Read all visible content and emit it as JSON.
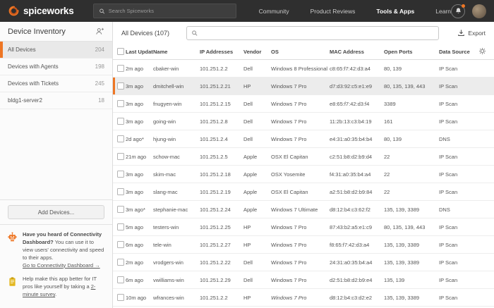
{
  "colors": {
    "accent_orange": "#ee7624",
    "topbar_bg": "#2f2f2f",
    "selected_row_bg": "#ececec",
    "survey_icon_yellow": "#e3b71f"
  },
  "topbar": {
    "logo_text": "spiceworks",
    "search_placeholder": "Search Spiceworks",
    "nav": [
      {
        "label": "Community",
        "active": false
      },
      {
        "label": "Product Reviews",
        "active": false
      },
      {
        "label": "Tools & Apps",
        "active": true
      },
      {
        "label": "Learn",
        "active": false
      }
    ]
  },
  "sidebar": {
    "title": "Device Inventory",
    "items": [
      {
        "label": "All Devices",
        "count": "204",
        "selected": true
      },
      {
        "label": "Devices with Agents",
        "count": "198",
        "selected": false
      },
      {
        "label": "Devices with Tickets",
        "count": "245",
        "selected": false
      },
      {
        "label": "bldg1-server2",
        "count": "18",
        "selected": false
      }
    ],
    "add_button": "Add Devices...",
    "promo": {
      "bold": "Have you heard of Connectivity Dashboard?",
      "text": " You can use it to view users' connectivity and speed to their apps.",
      "link": "Go to Connectivity Dashboard →"
    },
    "survey": {
      "before": "Help make this app better for IT pros like yourself by taking a ",
      "link": "2-minute survey",
      "after": "."
    }
  },
  "main": {
    "title": "All Devices (107)",
    "search_value": "",
    "export_label": "Export",
    "table": {
      "columns": [
        "Last Updated",
        "Name",
        "IP Addresses",
        "Vendor",
        "OS",
        "MAC Address",
        "Open Ports",
        "Data Source"
      ],
      "rows": [
        {
          "updated": "2m ago",
          "name": "cbaker-win",
          "ip": "101.251.2.2",
          "vendor": "Dell",
          "os": "Windows 8 Professional",
          "mac": "c8:65:f7:42:d3:a4",
          "ports": "80, 139",
          "source": "IP Scan",
          "highlighted": false,
          "os_italic": false
        },
        {
          "updated": "3m ago",
          "name": "dmitchell-win",
          "ip": "101.251.2.21",
          "vendor": "HP",
          "os": "Windows 7 Pro",
          "mac": "d7:d3:92:c5:e1:e9",
          "ports": "80, 135, 139, 443",
          "source": "IP Scan",
          "highlighted": true,
          "os_italic": false
        },
        {
          "updated": "3m ago",
          "name": "fnugyen-win",
          "ip": "101.251.2.15",
          "vendor": "Dell",
          "os": "Windows 7 Pro",
          "mac": "e8:65:f7:42:d3:f4",
          "ports": "3389",
          "source": "IP Scan",
          "highlighted": false,
          "os_italic": false
        },
        {
          "updated": "3m ago",
          "name": "going-win",
          "ip": "101.251.2.8",
          "vendor": "Dell",
          "os": "Windows 7 Pro",
          "mac": "11:2b:13:c3:b4:19",
          "ports": "161",
          "source": "IP Scan",
          "highlighted": false,
          "os_italic": false
        },
        {
          "updated": "2d ago*",
          "name": "hjung-win",
          "ip": "101.251.2.4",
          "vendor": "Dell",
          "os": "Windows 7 Pro",
          "mac": "e4:31:a0:35:b4:b4",
          "ports": "80, 139",
          "source": "DNS",
          "highlighted": false,
          "os_italic": false
        },
        {
          "updated": "21m ago",
          "name": "schow-mac",
          "ip": "101.251.2.5",
          "vendor": "Apple",
          "os": "OSX El Capitan",
          "mac": "c2:51:b8:d2:b9:d4",
          "ports": "22",
          "source": "IP Scan",
          "highlighted": false,
          "os_italic": false
        },
        {
          "updated": "3m ago",
          "name": "skim-mac",
          "ip": "101.251.2.18",
          "vendor": "Apple",
          "os": "OSX Yosemite",
          "mac": "f4:31:a0:35:b4:a4",
          "ports": "22",
          "source": "IP Scan",
          "highlighted": false,
          "os_italic": false
        },
        {
          "updated": "3m ago",
          "name": "slang-mac",
          "ip": "101.251.2.19",
          "vendor": "Apple",
          "os": "OSX El Capitan",
          "mac": "a2:51:b8:d2:b9:84",
          "ports": "22",
          "source": "IP Scan",
          "highlighted": false,
          "os_italic": false
        },
        {
          "updated": "3m ago*",
          "name": "stephanie-mac",
          "ip": "101.251.2.24",
          "vendor": "Apple",
          "os": "Windows 7 Ultimate",
          "mac": "d8:12:b4:c3:62:f2",
          "ports": "135, 139, 3389",
          "source": "DNS",
          "highlighted": false,
          "os_italic": false
        },
        {
          "updated": "5m ago",
          "name": "testers-win",
          "ip": "101.251.2.25",
          "vendor": "HP",
          "os": "Windows 7 Pro",
          "mac": "87:43:b2:a5:e1:c9",
          "ports": "80, 135, 139, 443",
          "source": "IP Scan",
          "highlighted": false,
          "os_italic": false
        },
        {
          "updated": "6m ago",
          "name": "tele-win",
          "ip": "101.251.2.27",
          "vendor": "HP",
          "os": "Windows 7 Pro",
          "mac": "f8:65:f7:42:d3:a4",
          "ports": "135, 139, 3389",
          "source": "IP Scan",
          "highlighted": false,
          "os_italic": false
        },
        {
          "updated": "2m ago",
          "name": "vrodgers-win",
          "ip": "101.251.2.22",
          "vendor": "Dell",
          "os": "Windows 7 Pro",
          "mac": "24:31:a0:35:b4:a4",
          "ports": "135, 139, 3389",
          "source": "IP Scan",
          "highlighted": false,
          "os_italic": false
        },
        {
          "updated": "6m ago",
          "name": "vwilliams-win",
          "ip": "101.251.2.29",
          "vendor": "Dell",
          "os": "Windows 7 Pro",
          "mac": "d2:51:b8:d2:b9:e4",
          "ports": "135, 139",
          "source": "IP Scan",
          "highlighted": false,
          "os_italic": false
        },
        {
          "updated": "10m ago",
          "name": "wfrances-win",
          "ip": "101.251.2.2",
          "vendor": "HP",
          "os": "Windows 7 Pro",
          "mac": "d8:12:b4:c3:d2:e2",
          "ports": "135, 139, 3389",
          "source": "IP Scan",
          "highlighted": false,
          "os_italic": true
        }
      ]
    }
  }
}
